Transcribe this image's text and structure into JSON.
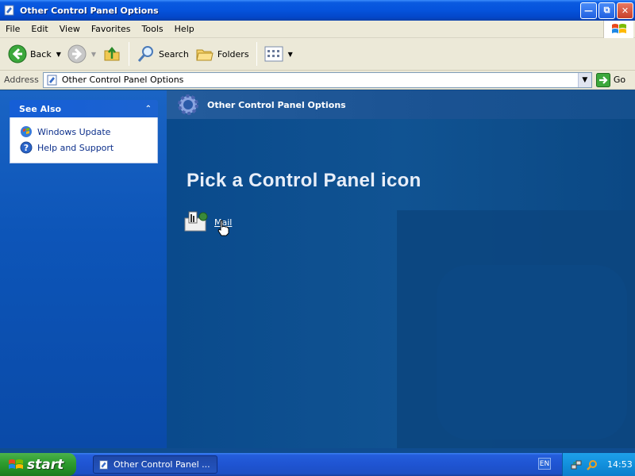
{
  "window": {
    "title": "Other Control Panel Options"
  },
  "menu": {
    "items": [
      "File",
      "Edit",
      "View",
      "Favorites",
      "Tools",
      "Help"
    ]
  },
  "toolbar": {
    "back_label": "Back",
    "search_label": "Search",
    "folders_label": "Folders"
  },
  "address": {
    "label": "Address",
    "value": "Other Control Panel Options",
    "go_label": "Go"
  },
  "see_also": {
    "title": "See Also",
    "items": [
      {
        "label": "Windows Update",
        "icon": "windows-update-icon"
      },
      {
        "label": "Help and Support",
        "icon": "help-icon"
      }
    ]
  },
  "content": {
    "header_title": "Other Control Panel Options",
    "pick_title": "Pick a Control Panel icon",
    "icons": [
      {
        "label": "Mail",
        "icon": "mail-icon"
      }
    ]
  },
  "taskbar": {
    "start_label": "start",
    "task_label": "Other Control Panel ...",
    "language": "EN",
    "clock": "14:53"
  },
  "colors": {
    "title_blue": "#0553dc",
    "pane_blue": "#0d55b8",
    "content_blue": "#105392",
    "start_green": "#2f9e30"
  }
}
